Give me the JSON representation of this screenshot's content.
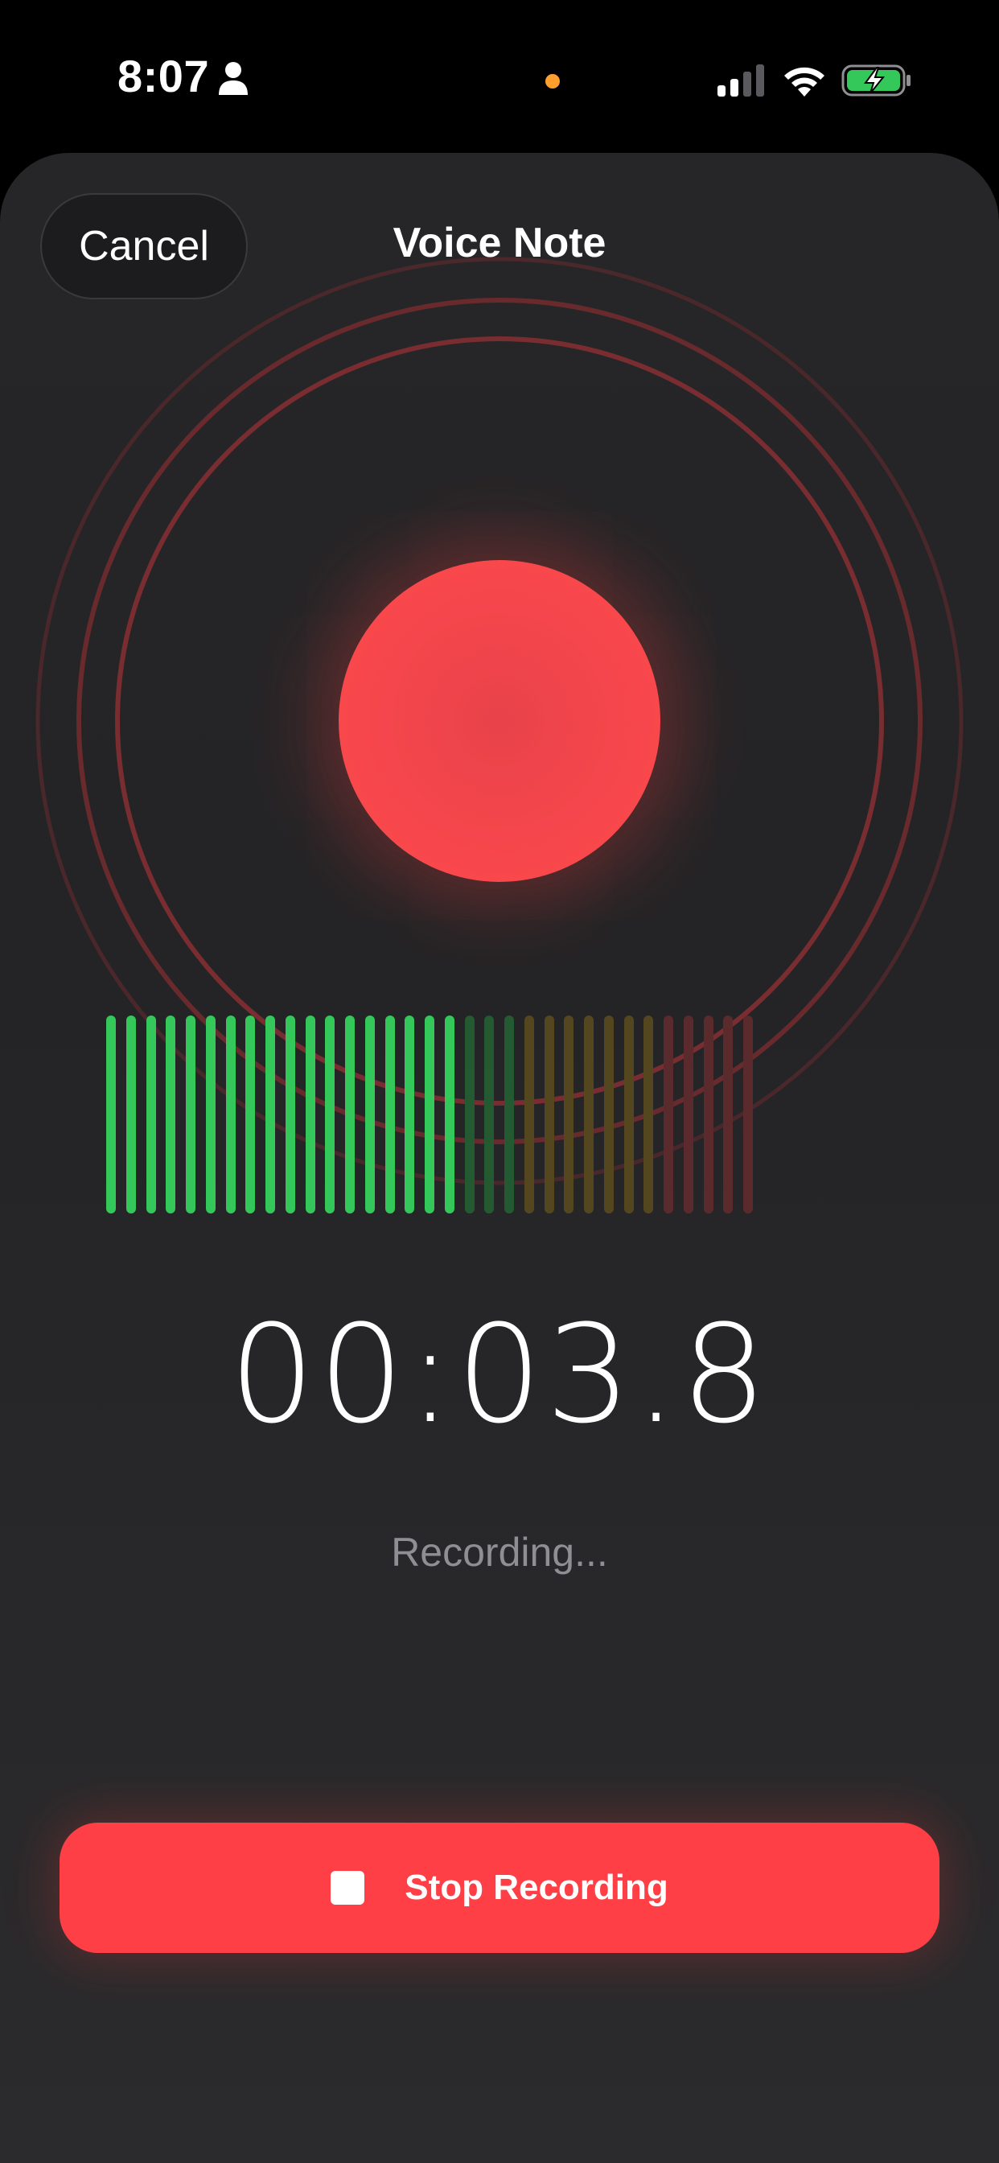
{
  "status_bar": {
    "time": "8:07",
    "icons": [
      "person-icon",
      "mic-indicator-dot",
      "signal-icon",
      "wifi-icon",
      "battery-charging-icon"
    ],
    "mic_indicator_color": "#ff9f2e",
    "battery_color": "#34c759"
  },
  "header": {
    "cancel_label": "Cancel",
    "title": "Voice Note"
  },
  "recorder": {
    "timer": "00:03.8",
    "status": "Recording...",
    "accent_color": "#ff3f46",
    "level_meter": {
      "bar_count": 33,
      "active_bars": 18,
      "colors": {
        "active": "#34c759",
        "low_inactive": "#245a32",
        "mid_inactive": "#54461f",
        "high_inactive": "#5a2a2c"
      }
    }
  },
  "actions": {
    "stop_label": "Stop Recording"
  }
}
